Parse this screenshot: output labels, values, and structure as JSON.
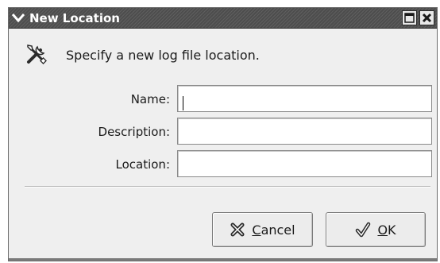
{
  "window": {
    "title": "New Location",
    "menu_icon": "chevron-down-icon",
    "maximize_icon": "maximize-icon",
    "close_icon": "close-icon"
  },
  "header": {
    "icon": "tools-icon",
    "text": "Specify a new log file location."
  },
  "form": {
    "name": {
      "label": "Name:",
      "value": ""
    },
    "description": {
      "label": "Description:",
      "value": ""
    },
    "location": {
      "label": "Location:",
      "value": ""
    }
  },
  "buttons": {
    "cancel": {
      "mnemonic": "C",
      "rest": "ancel",
      "icon": "cancel-icon"
    },
    "ok": {
      "mnemonic": "O",
      "rest": "K",
      "icon": "ok-icon"
    }
  },
  "colors": {
    "titlebar": "#4d4d4d",
    "dialog_bg": "#efefef",
    "input_bg": "#ffffff"
  }
}
